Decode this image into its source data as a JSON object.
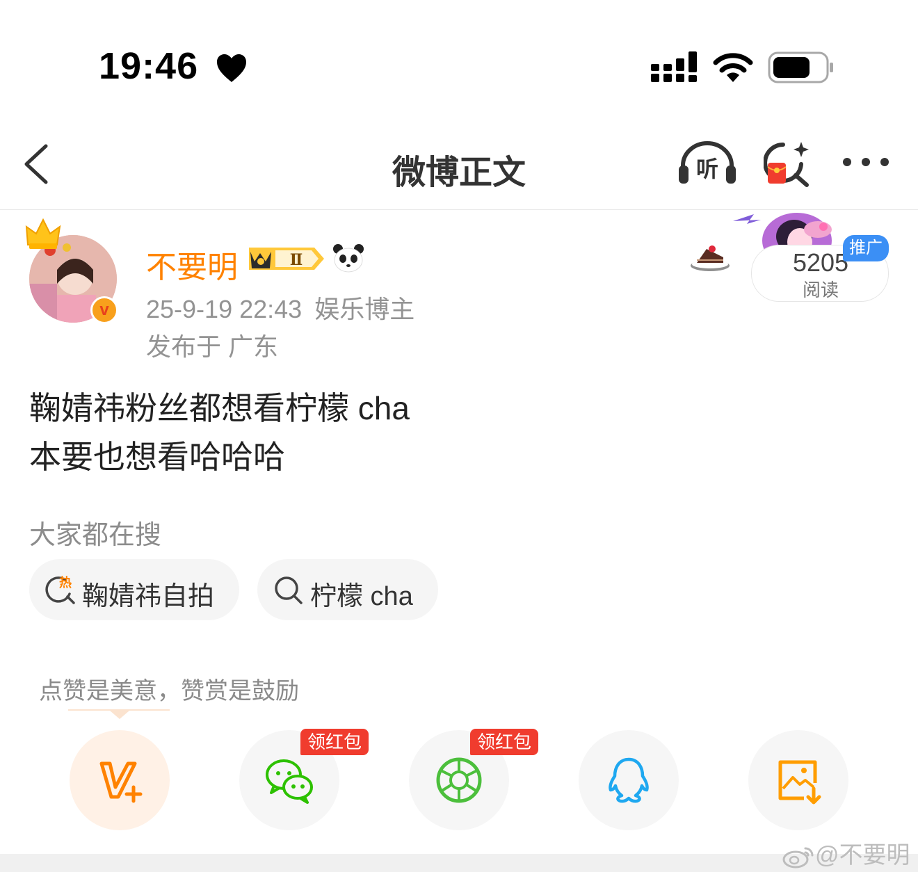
{
  "status_bar": {
    "time": "19:46"
  },
  "nav": {
    "title": "微博正文"
  },
  "user": {
    "name": "不要明",
    "member_level": "Ⅱ",
    "verified_mark": "v",
    "timestamp": "25-9-19 22:43",
    "category": "娱乐博主",
    "location": "发布于 广东"
  },
  "read_card": {
    "count": "5205",
    "label": "阅读",
    "promo": "推广"
  },
  "post": {
    "lines": [
      "鞠婧祎粉丝都想看柠檬 cha",
      "本要也想看哈哈哈"
    ]
  },
  "hot_search": {
    "label": "大家都在搜",
    "chips": [
      {
        "text": "鞠婧祎自拍",
        "icon": "hot-search-icon",
        "icon_text": "热"
      },
      {
        "text": "柠檬 cha",
        "icon": "search-icon"
      }
    ]
  },
  "share": {
    "hint": "点赞是美意，赞赏是鼓励",
    "buttons": [
      {
        "name": "vplus-reward",
        "icon": "v-plus-icon",
        "color": "#ff8200"
      },
      {
        "name": "wechat",
        "icon": "wechat-icon",
        "color": "#2dc100",
        "tag": "领红包"
      },
      {
        "name": "moments",
        "icon": "moments-icon",
        "color": "#4cbf3c",
        "tag": "领红包"
      },
      {
        "name": "qq",
        "icon": "qq-icon",
        "color": "#1fa8f0"
      },
      {
        "name": "save-image",
        "icon": "save-image-icon",
        "color": "#ff9d00"
      }
    ]
  },
  "watermark": "@不要明",
  "colors": {
    "accent": "#ff8200",
    "muted": "#939393",
    "promo_blue": "#3b8ff5",
    "red": "#f03c2e"
  }
}
